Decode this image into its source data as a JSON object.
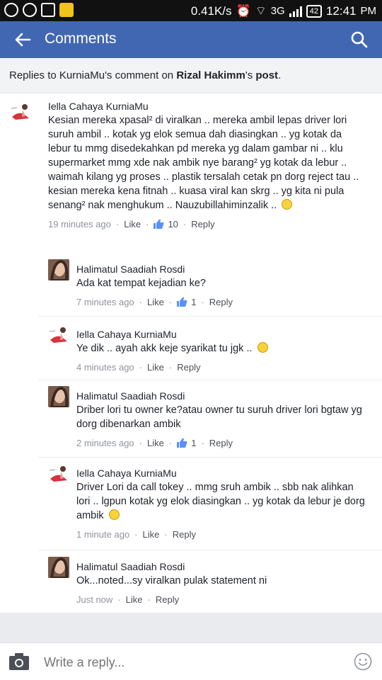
{
  "status_bar": {
    "network_speed": "0.41K/s",
    "network_type": "3G",
    "battery": "42",
    "time": "12:41",
    "ampm": "PM",
    "left_icons": [
      "add-icon",
      "whatsapp-icon",
      "shield-icon",
      "note-icon"
    ]
  },
  "app_bar": {
    "title": "Comments",
    "color": "#4267b2"
  },
  "context": {
    "prefix": "Replies to KurniaMu's comment on ",
    "poster": "Rizal Hakimm",
    "middle": "'s ",
    "post_word": "post",
    "suffix": "."
  },
  "comments": [
    {
      "author": "Iella Cahaya KurniaMu",
      "text": "Kesian mereka xpasal² di viralkan .. mereka ambil lepas driver lori suruh ambil .. kotak yg elok semua dah diasingkan .. yg kotak da lebur tu mmg disedekahkan pd mereka yg dalam gambar ni .. klu supermarket mmg xde nak ambik nye barang² yg kotak da lebur .. waimah kilang yg proses .. plastik tersalah cetak pn dorg reject tau .. kesian mereka kena fitnah .. kuasa viral kan skrg .. yg kita ni pula senang² nak menghukum .. Nauzubillahiminzalik ..",
      "emoji": "sad-face-icon",
      "time": "19 minutes ago",
      "like_label": "Like",
      "like_count": "10",
      "reply_label": "Reply"
    },
    {
      "author": "Halimatul Saadiah Rosdi",
      "text": "Ada kat tempat kejadian ke?",
      "time": "7 minutes ago",
      "like_label": "Like",
      "like_count": "1",
      "reply_label": "Reply"
    },
    {
      "author": "Iella Cahaya KurniaMu",
      "text": "Ye dik .. ayah akk keje syarikat tu jgk ..",
      "emoji": "smile-icon",
      "time": "4 minutes ago",
      "like_label": "Like",
      "reply_label": "Reply"
    },
    {
      "author": "Halimatul Saadiah Rosdi",
      "text": "Driber lori tu owner ke?atau owner tu suruh driver lori bgtaw yg dorg dibenarkan ambik",
      "time": "2 minutes ago",
      "like_label": "Like",
      "like_count": "1",
      "reply_label": "Reply"
    },
    {
      "author": "Iella Cahaya KurniaMu",
      "text": "Driver Lori da call tokey .. mmg sruh ambik .. sbb nak alihkan lori .. lgpun kotak yg elok diasingkan .. yg kotak da lebur je dorg ambik",
      "emoji": "smile-icon",
      "time": "1 minute ago",
      "like_label": "Like",
      "reply_label": "Reply"
    },
    {
      "author": "Halimatul Saadiah Rosdi",
      "text": "Ok...noted...sy viralkan pulak statement ni",
      "time": "Just now",
      "like_label": "Like",
      "reply_label": "Reply"
    }
  ],
  "composer": {
    "placeholder": "Write a reply..."
  }
}
